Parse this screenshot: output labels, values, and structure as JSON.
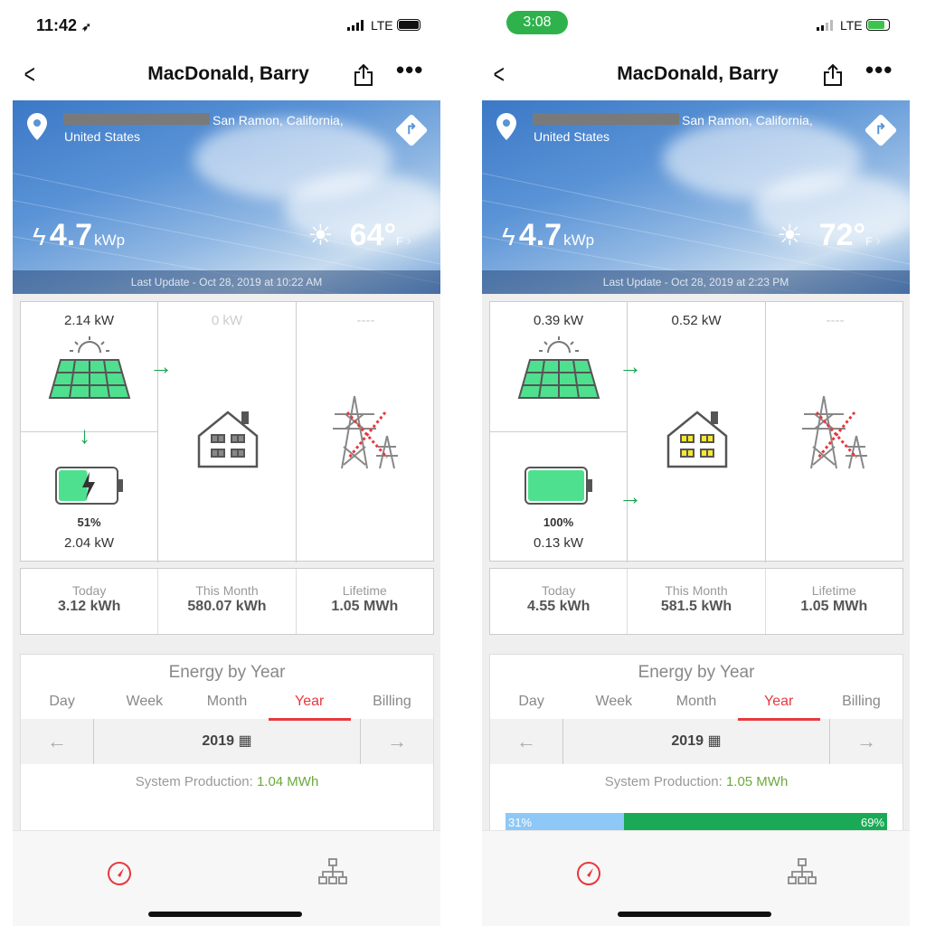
{
  "phones": [
    {
      "status": {
        "time": "11:42",
        "green_pill": false,
        "network": "LTE",
        "charging": false
      },
      "nav": {
        "title": "MacDonald, Barry",
        "back_icon": "chevron-left-icon",
        "share_icon": "share-icon",
        "more_icon": "ellipsis-icon"
      },
      "site": {
        "city": "San Ramon, California,",
        "country": "United States",
        "capacity": "4.7",
        "capacity_unit": "kWp",
        "temp": "64°",
        "temp_unit": "F",
        "last_update": "Last Update - Oct 28, 2019 at 10:22 AM"
      },
      "flow": {
        "solar_kw": "2.14 kW",
        "home_kw": "0 kW",
        "home_active": false,
        "grid": "----",
        "battery_pct": "51%",
        "battery_kw": "2.04 kW",
        "battery_charging": true,
        "battery_level": 51,
        "solar_to_battery": true,
        "battery_to_home": false
      },
      "stats": [
        {
          "label": "Today",
          "value": "3.12 kWh"
        },
        {
          "label": "This Month",
          "value": "580.07 kWh"
        },
        {
          "label": "Lifetime",
          "value": "1.05 MWh"
        }
      ],
      "energy": {
        "title": "Energy by Year",
        "tabs": [
          "Day",
          "Week",
          "Month",
          "Year",
          "Billing"
        ],
        "active_tab": "Year",
        "period": "2019",
        "prod_label": "System Production:",
        "prod_value": "1.04 MWh",
        "bar": null
      }
    },
    {
      "status": {
        "time": "3:08",
        "green_pill": true,
        "network": "LTE",
        "charging": true
      },
      "nav": {
        "title": "MacDonald, Barry",
        "back_icon": "chevron-left-icon",
        "share_icon": "share-icon",
        "more_icon": "ellipsis-icon"
      },
      "site": {
        "city": "San Ramon, California,",
        "country": "United States",
        "capacity": "4.7",
        "capacity_unit": "kWp",
        "temp": "72°",
        "temp_unit": "F",
        "last_update": "Last Update - Oct 28, 2019 at 2:23 PM"
      },
      "flow": {
        "solar_kw": "0.39 kW",
        "home_kw": "0.52 kW",
        "home_active": true,
        "grid": "----",
        "battery_pct": "100%",
        "battery_kw": "0.13 kW",
        "battery_charging": false,
        "battery_level": 100,
        "solar_to_battery": false,
        "battery_to_home": true
      },
      "stats": [
        {
          "label": "Today",
          "value": "4.55 kWh"
        },
        {
          "label": "This Month",
          "value": "581.5 kWh"
        },
        {
          "label": "Lifetime",
          "value": "1.05 MWh"
        }
      ],
      "energy": {
        "title": "Energy by Year",
        "tabs": [
          "Day",
          "Week",
          "Month",
          "Year",
          "Billing"
        ],
        "active_tab": "Year",
        "period": "2019",
        "prod_label": "System Production:",
        "prod_value": "1.05 MWh",
        "bar": {
          "left": "31%",
          "right": "69%",
          "left_pct": 31
        }
      }
    }
  ],
  "colors": {
    "accent": "#e8383d",
    "flow_green": "#1aa64f",
    "solar_green": "#4fe08f",
    "production_green": "#6aaa3a",
    "bar_blue": "#8ec8f6",
    "bar_green": "#1aaa55"
  }
}
